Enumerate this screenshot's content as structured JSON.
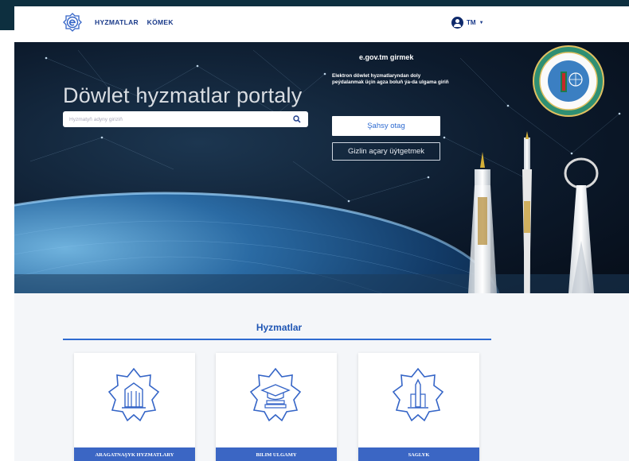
{
  "header": {
    "nav_services": "HYZMATLAR",
    "nav_help": "KÖMEK",
    "lang": "TM"
  },
  "hero": {
    "title": "Döwlet hyzmatlar portaly",
    "search_placeholder": "Hyzmatyň adyny giriziň"
  },
  "login": {
    "title": "e.gov.tm girmek",
    "description": "Elektron döwlet hyzmatlaryndan doly peýdalanmak üçin agza boluň ýa-da ulgama giriň",
    "cabinet_button": "Şahsy otag",
    "change_password_button": "Gizlin açary üýtgetmek"
  },
  "services": {
    "title": "Hyzmatlar",
    "cards": [
      {
        "label": "ARAGATNAŞYK HYZMATLARY",
        "icon": "building-icon"
      },
      {
        "label": "BILIM ULGAMY",
        "icon": "graduation-cap-books-icon"
      },
      {
        "label": "SAGLYK",
        "icon": "health-tower-icon"
      }
    ]
  },
  "colors": {
    "brand_blue": "#1f56b4",
    "card_label_bg": "#3b66c4",
    "hero_bg": "#0c1a2c"
  }
}
